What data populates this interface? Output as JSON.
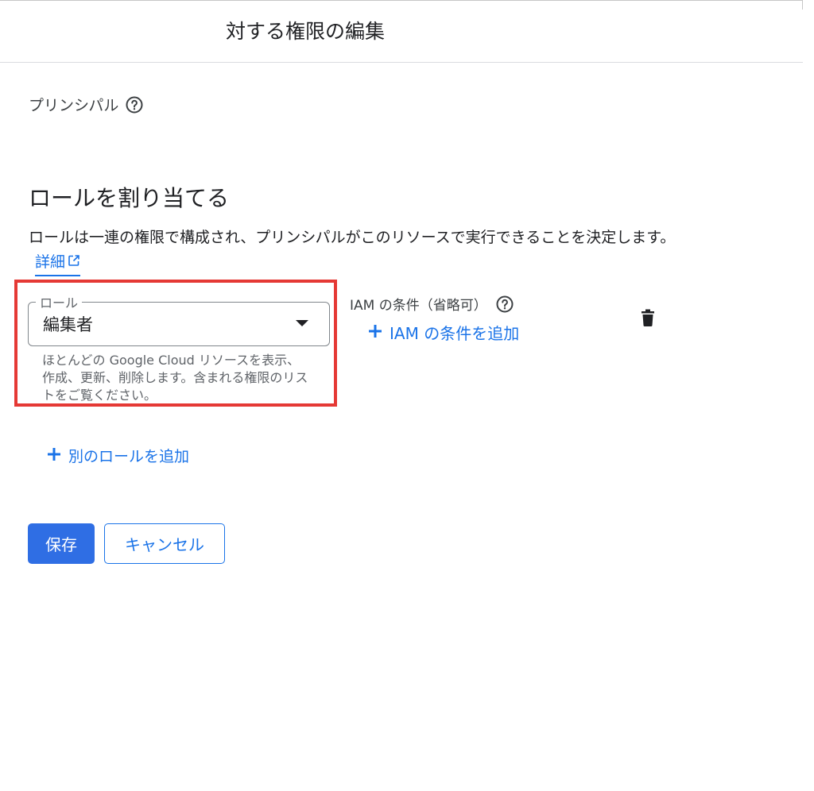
{
  "header": {
    "title": "対する権限の編集"
  },
  "principal": {
    "label": "プリンシパル",
    "help_icon": "help-circle-icon"
  },
  "assign_roles": {
    "title": "ロールを割り当てる",
    "description": "ロールは一連の権限で構成され、プリンシパルがこのリソースで実行できることを決定します。",
    "learn_more_label": "詳細",
    "learn_more_icon": "external-link-icon"
  },
  "role_field": {
    "legend": "ロール",
    "value": "編集者",
    "hint": "ほとんどの Google Cloud リソースを表示、作成、更新、削除します。含まれる権限のリストをご覧ください。",
    "caret_icon": "dropdown-caret-icon"
  },
  "iam_condition": {
    "label": "IAM の条件（省略可）",
    "help_icon": "help-circle-icon",
    "add_label": "IAM の条件を追加",
    "add_icon": "plus-icon"
  },
  "delete_icon": "trash-icon",
  "add_role": {
    "label": "別のロールを追加",
    "icon": "plus-icon"
  },
  "actions": {
    "save_label": "保存",
    "cancel_label": "キャンセル"
  },
  "colors": {
    "accent": "#1a73e8",
    "primary_button": "#2f6ee4",
    "highlight_border": "#e53935"
  }
}
